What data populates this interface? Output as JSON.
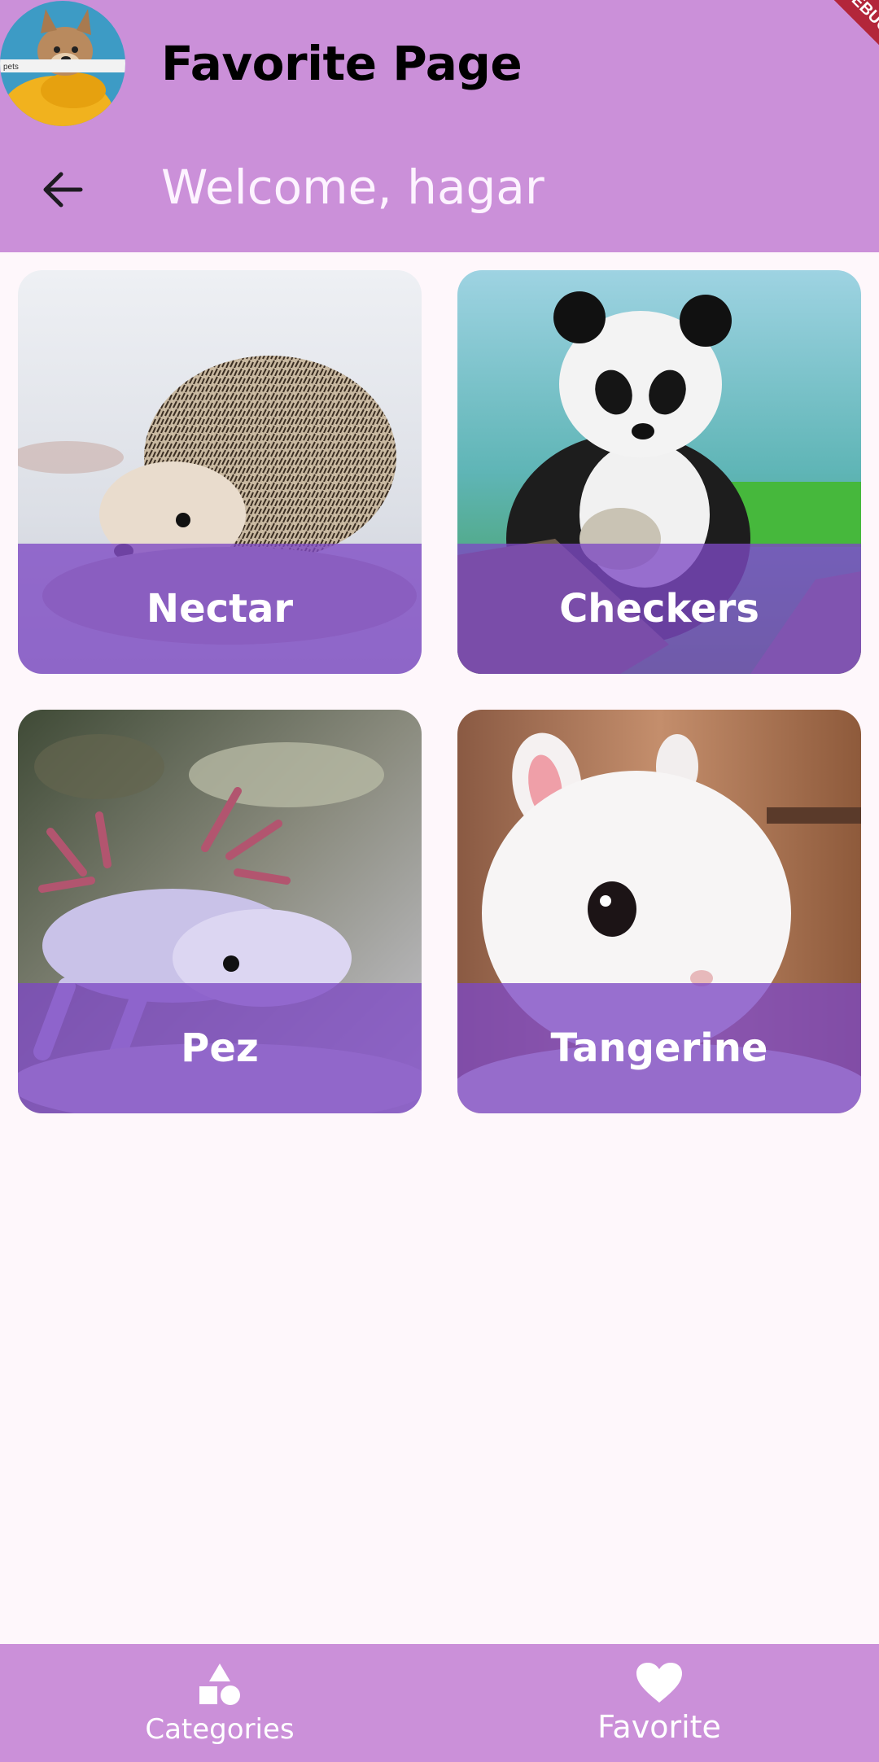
{
  "app_bar": {
    "title": "Favorite Page",
    "welcome_text": "Welcome, hagar",
    "avatar_caption": "pets",
    "background_color": "#cb90d9"
  },
  "debug_banner": {
    "label": "DEBUG"
  },
  "favorites": [
    {
      "name": "Nectar",
      "animal": "hedgehog"
    },
    {
      "name": "Checkers",
      "animal": "panda"
    },
    {
      "name": "Pez",
      "animal": "axolotl"
    },
    {
      "name": "Tangerine",
      "animal": "rabbit"
    }
  ],
  "bottom_nav": {
    "items": [
      {
        "label": "Categories",
        "icon": "shapes-icon",
        "selected": false
      },
      {
        "label": "Favorite",
        "icon": "heart-icon",
        "selected": true
      }
    ]
  },
  "colors": {
    "accent": "#cb90d9",
    "card_label_band": "#7e49c4",
    "page_background": "#fef7fb"
  }
}
